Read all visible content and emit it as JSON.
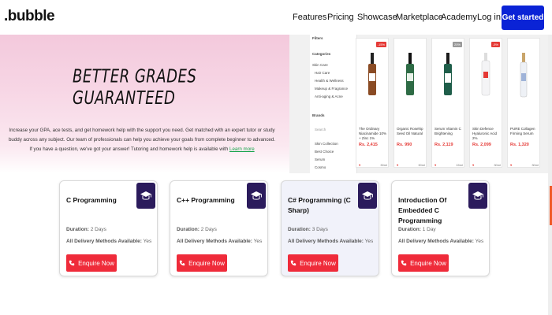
{
  "nav": {
    "logo": ".bubble",
    "links": [
      "Features",
      "Pricing",
      "Showcase",
      "Marketplace",
      "Academy"
    ],
    "login": "Log in",
    "cta": "Get started",
    "cta_color": "#0a23d6"
  },
  "hero": {
    "title": "BETTER GRADES GUARANTEED",
    "body": "Increase your GPA, ace tests, and get homework help with the support you need. Get matched with an expert tutor or study buddy across any subject. Our team of professionals can help you achieve your goals from complete beginner to advanced. If you have a question, we've got your answer! Tutoring and homework help is available with",
    "link": "Learn more"
  },
  "shop": {
    "filters": {
      "title": "Filters",
      "category_label": "Categories",
      "categories": [
        "Skin Care",
        "Hair Care",
        "Health & Wellness",
        "Makeup & Fragrance",
        "Anti-aging & Acne"
      ],
      "brand_label": "Brands",
      "brand_search": "Search",
      "brands": [
        "Skin Collection",
        "Best Choice",
        "Serum",
        "Cosmo"
      ]
    },
    "products": [
      {
        "badge": "-15%",
        "name": "The Ordinary Niacinamide 10% + Zinc 1%",
        "price": "Rs. 2,415",
        "meta": "30ml"
      },
      {
        "badge": "",
        "name": "Organic Rosehip Seed Oil Natural",
        "price": "Rs. 990",
        "meta": "30ml"
      },
      {
        "badge": "20%",
        "name": "Serum Vitamin C Brightening",
        "price": "Rs. 2,119",
        "meta": "15ml"
      },
      {
        "badge": "-5%",
        "name": "Skin Defence Hyaluronic Acid 2%",
        "price": "Rs. 2,099",
        "meta": "30ml"
      },
      {
        "badge": "",
        "name": "PURE Collagen Firming Serum",
        "price": "Rs. 1,320",
        "meta": "30ml"
      }
    ],
    "accent": "#e53935"
  },
  "courses": [
    {
      "title": "C Programming",
      "duration_label": "Duration:",
      "duration": "2 Days",
      "delivery_label": "All Delivery Methods Available:",
      "delivery": "Yes",
      "button": "Enquire Now"
    },
    {
      "title": "C++ Programming",
      "duration_label": "Duration:",
      "duration": "2 Days",
      "delivery_label": "All Delivery Methods Available:",
      "delivery": "Yes",
      "button": "Enquire Now"
    },
    {
      "title": "C# Programming (C Sharp)",
      "duration_label": "Duration:",
      "duration": "3 Days",
      "delivery_label": "All Delivery Methods Available:",
      "delivery": "Yes",
      "button": "Enquire Now"
    },
    {
      "title": "Introduction Of Embedded C Programming",
      "duration_label": "Duration:",
      "duration": "1 Day",
      "delivery_label": "All Delivery Methods Available:",
      "delivery": "Yes",
      "button": "Enquire Now"
    }
  ],
  "colors": {
    "enquire": "#ef2b3a",
    "course_icon": "#2b1b5c"
  },
  "icons": {
    "course": "graduation-cap-icon",
    "enquire": "phone-icon"
  }
}
